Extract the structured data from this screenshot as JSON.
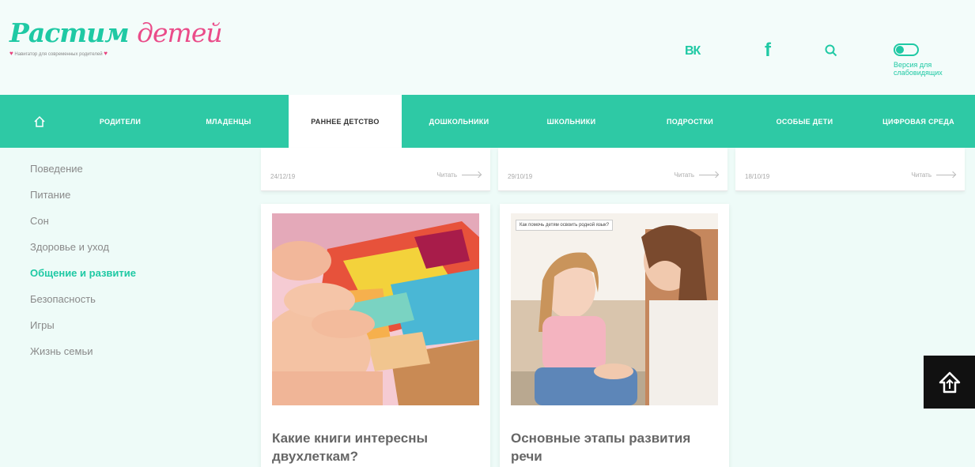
{
  "logo": {
    "part1": "Растим",
    "part2": "детей",
    "tagline": "Навигатор для современных родителей"
  },
  "header": {
    "vk": "ВК",
    "fb": "f",
    "accessibility": "Версия для слабовидящих"
  },
  "nav": {
    "items": [
      {
        "label": "РОДИТЕЛИ"
      },
      {
        "label": "МЛАДЕНЦЫ"
      },
      {
        "label": "РАННЕЕ ДЕТСТВО"
      },
      {
        "label": "ДОШКОЛЬНИКИ"
      },
      {
        "label": "ШКОЛЬНИКИ"
      },
      {
        "label": "ПОДРОСТКИ"
      },
      {
        "label": "ОСОБЫЕ ДЕТИ"
      },
      {
        "label": "ЦИФРОВАЯ СРЕДА"
      }
    ],
    "active_index": 2
  },
  "sidebar": {
    "items": [
      {
        "label": "Поведение"
      },
      {
        "label": "Питание"
      },
      {
        "label": "Сон"
      },
      {
        "label": "Здоровье и уход"
      },
      {
        "label": "Общение и развитие"
      },
      {
        "label": "Безопасность"
      },
      {
        "label": "Игры"
      },
      {
        "label": "Жизнь семьи"
      }
    ],
    "active_index": 4
  },
  "meta_cards": [
    {
      "date": "24/12/19",
      "read_label": "Читать"
    },
    {
      "date": "29/10/19",
      "read_label": "Читать"
    },
    {
      "date": "18/10/19",
      "read_label": "Читать"
    }
  ],
  "articles": [
    {
      "title": "Какие книги интересны двухлеткам?"
    },
    {
      "title": "Основные этапы развития речи",
      "image_caption": "Как помочь детям освоить родной язык?"
    }
  ],
  "colors": {
    "accent": "#2ec9a5",
    "logo_pink": "#ea4c89",
    "background": "#eefbf8"
  }
}
